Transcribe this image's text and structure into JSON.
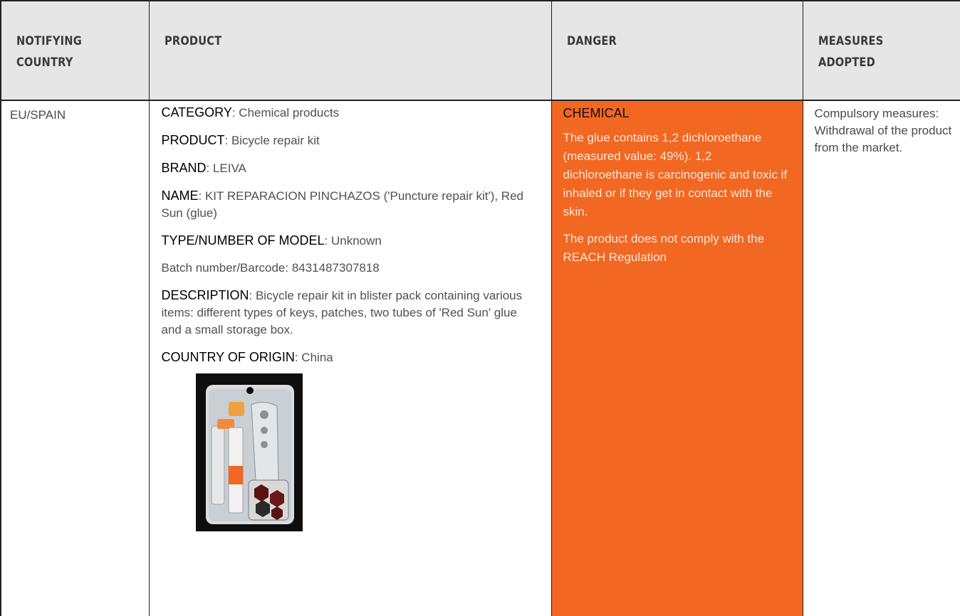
{
  "headers": {
    "country": [
      "NOTIFYING",
      "COUNTRY"
    ],
    "product": "PRODUCT",
    "danger": "DANGER",
    "measures": [
      "MEASURES",
      "ADOPTED"
    ]
  },
  "row": {
    "country": "EU/SPAIN",
    "product": {
      "category_label": "CATEGORY",
      "category_value": ": Chemical products",
      "product_label": "PRODUCT",
      "product_value": ": Bicycle repair kit",
      "brand_label": "BRAND",
      "brand_value": ": LEIVA",
      "name_label": "NAME",
      "name_value": ": KIT REPARACION PINCHAZOS ('Puncture repair kit'), Red Sun (glue)",
      "model_label": "TYPE/NUMBER OF MODEL",
      "model_value": ": Unknown",
      "batch": "Batch number/Barcode: 8431487307818",
      "description_label": "DESCRIPTION",
      "description_value": ": Bicycle repair kit in blister pack containing various items: different types of keys, patches, two tubes of 'Red Sun' glue and a small storage box.",
      "origin_label": "COUNTRY OF ORIGIN",
      "origin_value": ": China"
    },
    "danger": {
      "title": "CHEMICAL",
      "text1": "The glue contains 1,2 dichloroethane (measured value: 49%). 1,2 dichloroethane is carcinogenic and toxic if inhaled or if they get in contact with the skin.",
      "text2": "The product does not comply with the REACH Regulation",
      "color": "#f26722"
    },
    "measures": "Compulsory measures: Withdrawal of the product from the market."
  }
}
